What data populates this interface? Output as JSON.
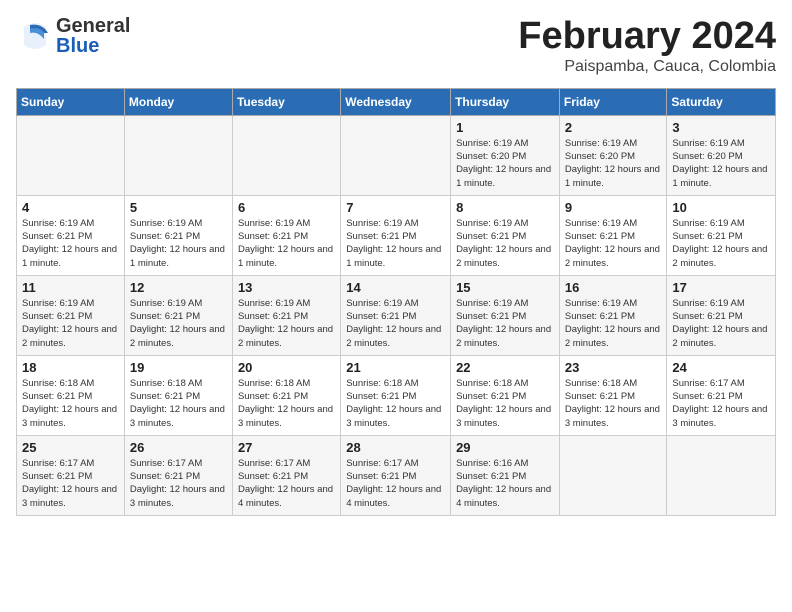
{
  "header": {
    "logo_general": "General",
    "logo_blue": "Blue",
    "month": "February 2024",
    "location": "Paispamba, Cauca, Colombia"
  },
  "days_of_week": [
    "Sunday",
    "Monday",
    "Tuesday",
    "Wednesday",
    "Thursday",
    "Friday",
    "Saturday"
  ],
  "weeks": [
    [
      {
        "day": "",
        "info": ""
      },
      {
        "day": "",
        "info": ""
      },
      {
        "day": "",
        "info": ""
      },
      {
        "day": "",
        "info": ""
      },
      {
        "day": "1",
        "info": "Sunrise: 6:19 AM\nSunset: 6:20 PM\nDaylight: 12 hours and 1 minute."
      },
      {
        "day": "2",
        "info": "Sunrise: 6:19 AM\nSunset: 6:20 PM\nDaylight: 12 hours and 1 minute."
      },
      {
        "day": "3",
        "info": "Sunrise: 6:19 AM\nSunset: 6:20 PM\nDaylight: 12 hours and 1 minute."
      }
    ],
    [
      {
        "day": "4",
        "info": "Sunrise: 6:19 AM\nSunset: 6:21 PM\nDaylight: 12 hours and 1 minute."
      },
      {
        "day": "5",
        "info": "Sunrise: 6:19 AM\nSunset: 6:21 PM\nDaylight: 12 hours and 1 minute."
      },
      {
        "day": "6",
        "info": "Sunrise: 6:19 AM\nSunset: 6:21 PM\nDaylight: 12 hours and 1 minute."
      },
      {
        "day": "7",
        "info": "Sunrise: 6:19 AM\nSunset: 6:21 PM\nDaylight: 12 hours and 1 minute."
      },
      {
        "day": "8",
        "info": "Sunrise: 6:19 AM\nSunset: 6:21 PM\nDaylight: 12 hours and 2 minutes."
      },
      {
        "day": "9",
        "info": "Sunrise: 6:19 AM\nSunset: 6:21 PM\nDaylight: 12 hours and 2 minutes."
      },
      {
        "day": "10",
        "info": "Sunrise: 6:19 AM\nSunset: 6:21 PM\nDaylight: 12 hours and 2 minutes."
      }
    ],
    [
      {
        "day": "11",
        "info": "Sunrise: 6:19 AM\nSunset: 6:21 PM\nDaylight: 12 hours and 2 minutes."
      },
      {
        "day": "12",
        "info": "Sunrise: 6:19 AM\nSunset: 6:21 PM\nDaylight: 12 hours and 2 minutes."
      },
      {
        "day": "13",
        "info": "Sunrise: 6:19 AM\nSunset: 6:21 PM\nDaylight: 12 hours and 2 minutes."
      },
      {
        "day": "14",
        "info": "Sunrise: 6:19 AM\nSunset: 6:21 PM\nDaylight: 12 hours and 2 minutes."
      },
      {
        "day": "15",
        "info": "Sunrise: 6:19 AM\nSunset: 6:21 PM\nDaylight: 12 hours and 2 minutes."
      },
      {
        "day": "16",
        "info": "Sunrise: 6:19 AM\nSunset: 6:21 PM\nDaylight: 12 hours and 2 minutes."
      },
      {
        "day": "17",
        "info": "Sunrise: 6:19 AM\nSunset: 6:21 PM\nDaylight: 12 hours and 2 minutes."
      }
    ],
    [
      {
        "day": "18",
        "info": "Sunrise: 6:18 AM\nSunset: 6:21 PM\nDaylight: 12 hours and 3 minutes."
      },
      {
        "day": "19",
        "info": "Sunrise: 6:18 AM\nSunset: 6:21 PM\nDaylight: 12 hours and 3 minutes."
      },
      {
        "day": "20",
        "info": "Sunrise: 6:18 AM\nSunset: 6:21 PM\nDaylight: 12 hours and 3 minutes."
      },
      {
        "day": "21",
        "info": "Sunrise: 6:18 AM\nSunset: 6:21 PM\nDaylight: 12 hours and 3 minutes."
      },
      {
        "day": "22",
        "info": "Sunrise: 6:18 AM\nSunset: 6:21 PM\nDaylight: 12 hours and 3 minutes."
      },
      {
        "day": "23",
        "info": "Sunrise: 6:18 AM\nSunset: 6:21 PM\nDaylight: 12 hours and 3 minutes."
      },
      {
        "day": "24",
        "info": "Sunrise: 6:17 AM\nSunset: 6:21 PM\nDaylight: 12 hours and 3 minutes."
      }
    ],
    [
      {
        "day": "25",
        "info": "Sunrise: 6:17 AM\nSunset: 6:21 PM\nDaylight: 12 hours and 3 minutes."
      },
      {
        "day": "26",
        "info": "Sunrise: 6:17 AM\nSunset: 6:21 PM\nDaylight: 12 hours and 3 minutes."
      },
      {
        "day": "27",
        "info": "Sunrise: 6:17 AM\nSunset: 6:21 PM\nDaylight: 12 hours and 4 minutes."
      },
      {
        "day": "28",
        "info": "Sunrise: 6:17 AM\nSunset: 6:21 PM\nDaylight: 12 hours and 4 minutes."
      },
      {
        "day": "29",
        "info": "Sunrise: 6:16 AM\nSunset: 6:21 PM\nDaylight: 12 hours and 4 minutes."
      },
      {
        "day": "",
        "info": ""
      },
      {
        "day": "",
        "info": ""
      }
    ]
  ]
}
